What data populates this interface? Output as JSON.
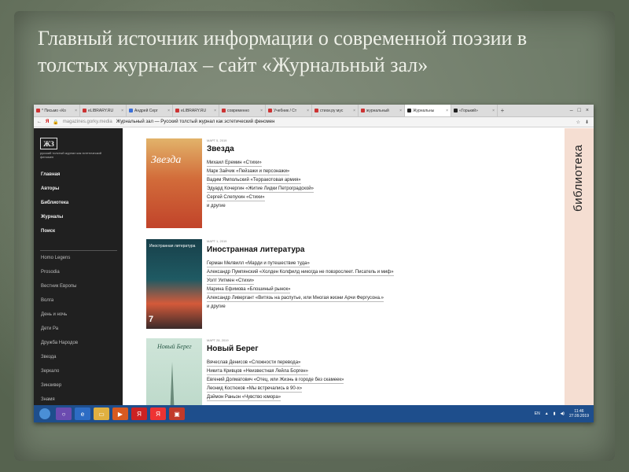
{
  "slide": {
    "title_line1": "Главный источник информации о современной поэзии в",
    "title_line2": "толстых  журналах – сайт «Журнальный зал»"
  },
  "browser": {
    "tabs": [
      {
        "label": "* Письмо «Ко",
        "active": false
      },
      {
        "label": "eLIBRARY.RU",
        "active": false
      },
      {
        "label": "Андрей Серг",
        "active": false
      },
      {
        "label": "eLIBRARY.RU",
        "active": false
      },
      {
        "label": "современно",
        "active": false
      },
      {
        "label": "Учебник / Ст",
        "active": false
      },
      {
        "label": "стихи.ру мус",
        "active": false
      },
      {
        "label": "журнальный",
        "active": false
      },
      {
        "label": "Журнальны",
        "active": true
      },
      {
        "label": "«Горький»",
        "active": false
      }
    ],
    "url_domain": "magazines.gorky.media",
    "page_title": "Журнальный зал — Русский толстый журнал как эстетический феномен"
  },
  "sidebar": {
    "logo": "ЖЗ",
    "logo_sub": "русский толстый журнал как эстетический феномен",
    "nav": [
      "Главная",
      "Авторы",
      "Библиотека",
      "Журналы",
      "Поиск"
    ],
    "magazines": [
      "Homo Legens",
      "Prosodia",
      "Вестник Европы",
      "Волга",
      "День и ночь",
      "Дети Ра",
      "Дружба Народов",
      "Звезда",
      "Зеркало",
      "Зинзивер",
      "Знамя"
    ]
  },
  "entries": [
    {
      "cover_text": "Звезда",
      "date": "МАРТ 5, 2019",
      "name": "Звезда",
      "lines": [
        "Михаил Еремин «Стихи»",
        "Марк Зайчик «Пейзажи и персонажи»",
        "Вадим Ямпольский «Терракотовая армия»",
        "Эдуард Кочергин «Житие Лидки Петроградской»",
        "Сергей Слепухин «Стихи»"
      ],
      "more": "и другие"
    },
    {
      "cover_text": "Иностранная литература",
      "cover_num": "7",
      "date": "МАРТ 1, 2019",
      "name": "Иностранная литература",
      "lines": [
        "Герман Мелвилл «Марди и путешествие туда»",
        "Александр Пумпянский «Холден Колфилд никогда не повзрослеет. Писатель и миф»",
        "Уолт Уитмен «Стихи»",
        "Марина Ефимова «Блошиный рынок»",
        "Александр Ливергант «Витязь на распутье, или Многая жизни Арчи Фергусона.»"
      ],
      "more": "и другие"
    },
    {
      "cover_text": "Новый Берег",
      "date": "МАРТ 28, 2019",
      "name": "Новый Берег",
      "lines": [
        "Вячеслав Денисов «Сложности перевода»",
        "Никита Кривцов «Неизвестная Лейла Борген»",
        "Евгений Долматович «Отец, или Жизнь в городе без скамеек»",
        "Леонид Костюков «Мы встречались в 90-х»",
        "Дэймон Раньон «Чувство юмора»"
      ]
    }
  ],
  "right_strip": "библиотека",
  "taskbar": {
    "lang": "EN",
    "time": "11:46",
    "date": "27.09.2019"
  }
}
